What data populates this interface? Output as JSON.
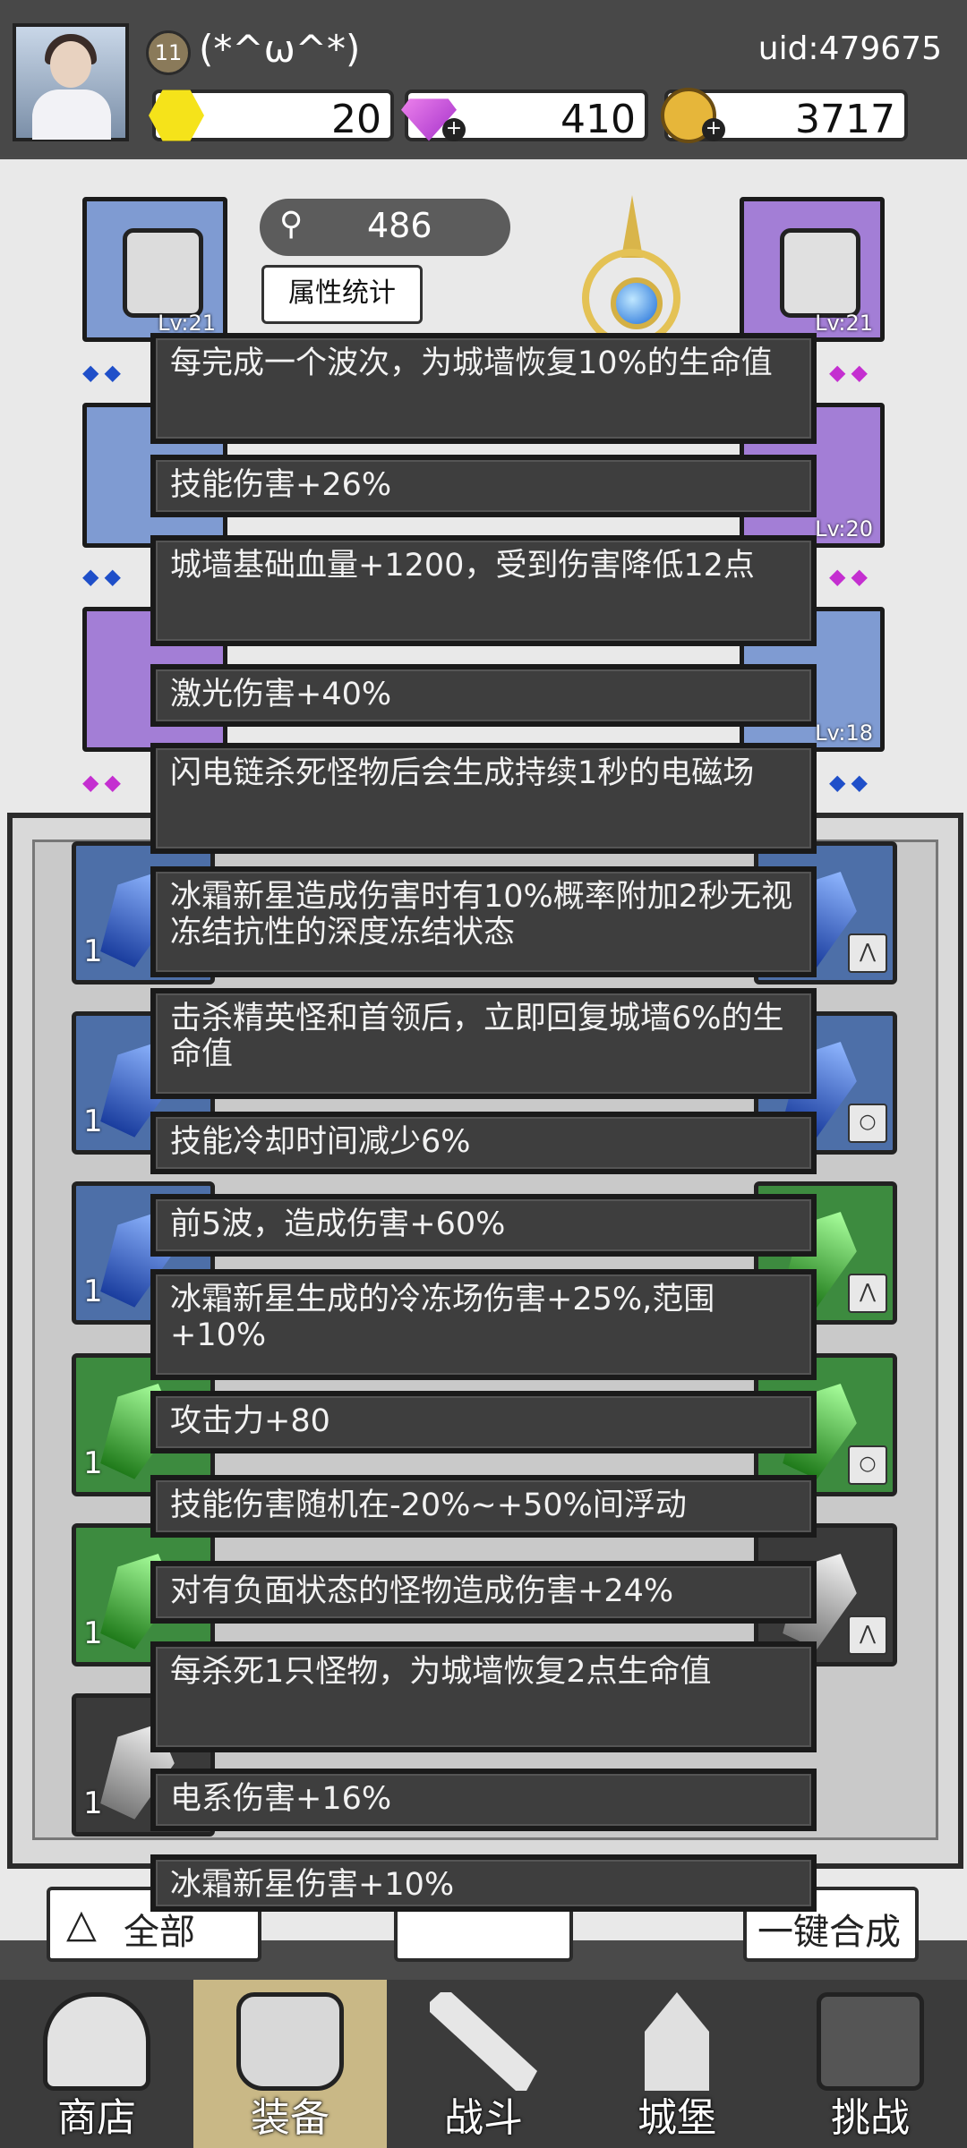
{
  "header": {
    "level": "11",
    "nickname": "(*^ω^*)",
    "uid": "uid:479675",
    "gold": "20",
    "gems": "410",
    "coins": "3717"
  },
  "equipment": {
    "power": "486",
    "stats_button": "属性统计",
    "slots": [
      {
        "level": "Lv:21"
      },
      {
        "level": "Lv:21"
      },
      {
        "level": "Lv:20"
      },
      {
        "level": "Lv:18"
      }
    ]
  },
  "tooltips": [
    "每完成一个波次，为城墙恢复10%的生命值",
    "技能伤害+26%",
    "城墙基础血量+1200，受到伤害降低12点",
    "激光伤害+40%",
    "闪电链杀死怪物后会生成持续1秒的电磁场",
    "冰霜新星造成伤害时有10%概率附加2秒无视冻结抗性的深度冻结状态",
    "击杀精英怪和首领后，立即回复城墙6%的生命值",
    "技能冷却时间减少6%",
    "前5波，造成伤害+60%",
    "冰霜新星生成的冷冻场伤害+25%,范围+10%",
    "攻击力+80",
    "技能伤害随机在-20%~+50%间浮动",
    "对有负面状态的怪物造成伤害+24%",
    "每杀死1只怪物，为城墙恢复2点生命值",
    "电系伤害+16%",
    "冰霜新星伤害+10%"
  ],
  "inventory": {
    "count_label": "1",
    "left_button": "全部",
    "right_button": "一键合成"
  },
  "nav": {
    "shop": "商店",
    "equip": "装备",
    "battle": "战斗",
    "castle": "城堡",
    "challenge": "挑战"
  },
  "colors": {
    "tooltip_bg": "#3e3e3e",
    "nav_active": "#c9b886",
    "blue_slot": "#7f9bd2",
    "purple_slot": "#a37ed6"
  }
}
